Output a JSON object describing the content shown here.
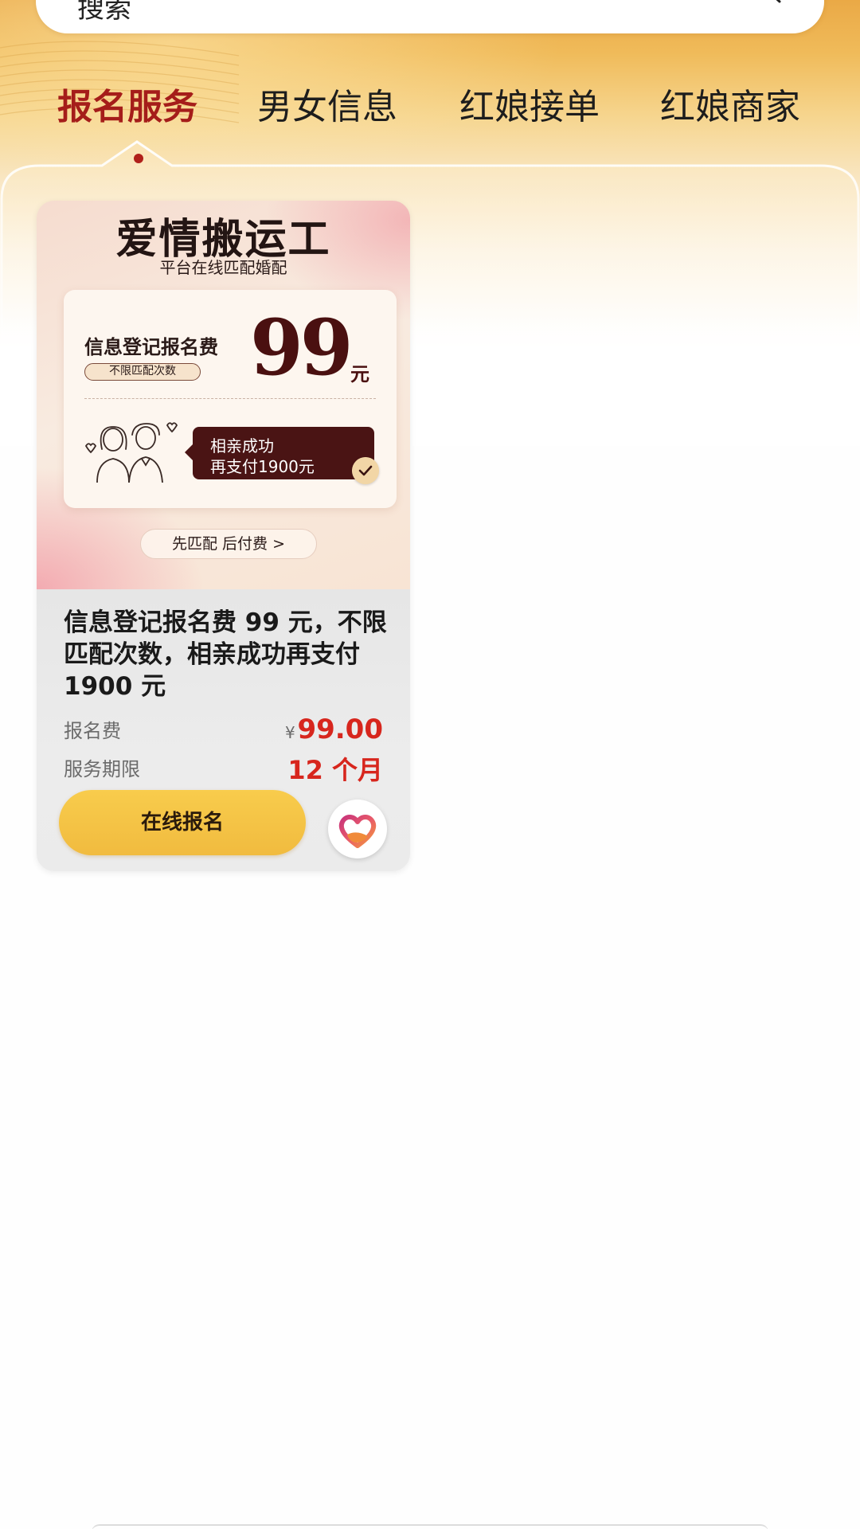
{
  "search": {
    "placeholder": "搜索",
    "icon": "search-icon"
  },
  "tabs": [
    {
      "label": "报名服务",
      "active": true
    },
    {
      "label": "男女信息",
      "active": false
    },
    {
      "label": "红娘接单",
      "active": false
    },
    {
      "label": "红娘商家",
      "active": false
    }
  ],
  "card": {
    "poster": {
      "title": "爱情搬运工",
      "subtitle": "平台在线匹配婚配",
      "fee_label": "信息登记报名费",
      "fee_chip": "不限匹配次数",
      "fee_amount": "99",
      "fee_unit": "元",
      "success_line1": "相亲成功",
      "success_line2": "再支付1900元",
      "cta": "先匹配 后付费 >"
    },
    "description": "信息登记报名费 99 元，不限匹配次数，相亲成功再支付 1900 元",
    "price_label": "报名费",
    "price_currency": "¥",
    "price_value": "99.00",
    "period_label": "服务期限",
    "period_value": "12 个月",
    "button_label": "在线报名",
    "logo": "heart-hands-logo"
  },
  "colors": {
    "header_gold": "#eaa946",
    "active_tab": "#a51d1a",
    "price_red": "#d7261d",
    "button_yellow": "#f8cc4c",
    "poster_dark": "#4a1414"
  }
}
